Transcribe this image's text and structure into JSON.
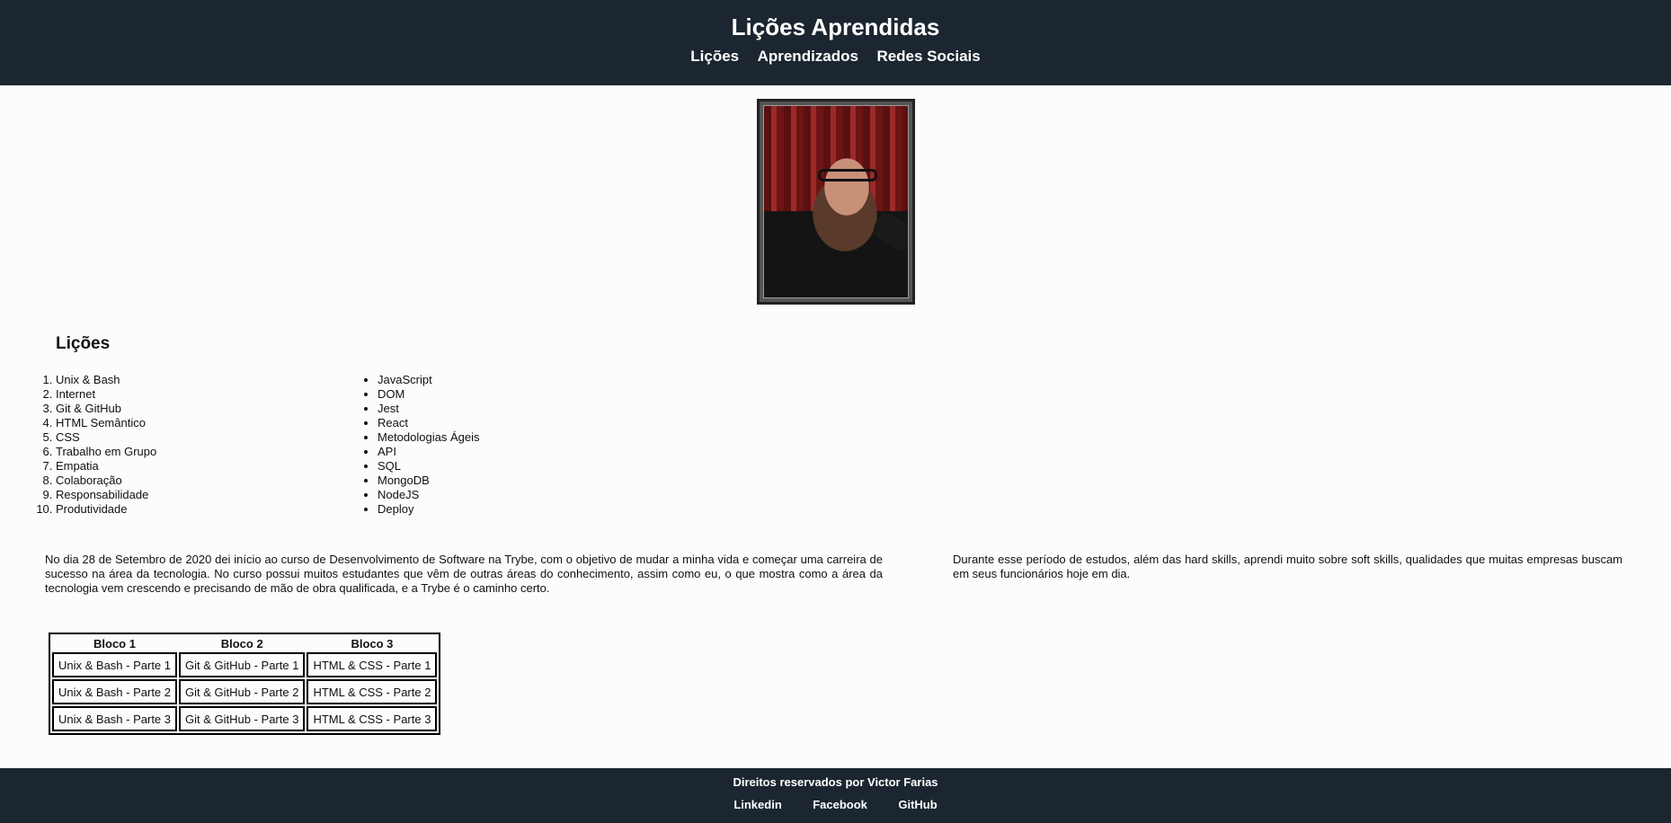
{
  "header": {
    "title": "Lições Aprendidas",
    "nav": [
      "Lições",
      "Aprendizados",
      "Redes Sociais"
    ]
  },
  "lessons": {
    "title": "Lições",
    "ordered": [
      "Unix & Bash",
      "Internet",
      "Git & GitHub",
      "HTML Semântico",
      "CSS",
      "Trabalho em Grupo",
      "Empatia",
      "Colaboração",
      "Responsabilidade",
      "Produtividade"
    ],
    "unordered": [
      "JavaScript",
      "DOM",
      "Jest",
      "React",
      "Metodologias Ágeis",
      "API",
      "SQL",
      "MongoDB",
      "NodeJS",
      "Deploy"
    ]
  },
  "paragraphs": {
    "left": "No dia 28 de Setembro de 2020 dei início ao curso de Desenvolvimento de Software na Trybe, com o objetivo de mudar a minha vida e começar uma carreira de sucesso na área da tecnologia. No curso possui muitos estudantes que vêm de outras áreas do conhecimento, assim como eu, o que mostra como a área da tecnologia vem crescendo e precisando de mão de obra qualificada, e a Trybe é o caminho certo.",
    "right": "Durante esse período de estudos, além das hard skills, aprendi muito sobre soft skills, qualidades que muitas empresas buscam em seus funcionários hoje em dia."
  },
  "table": {
    "headers": [
      "Bloco 1",
      "Bloco 2",
      "Bloco 3"
    ],
    "rows": [
      [
        "Unix & Bash - Parte 1",
        "Git & GitHub - Parte 1",
        "HTML & CSS - Parte 1"
      ],
      [
        "Unix & Bash - Parte 2",
        "Git & GitHub - Parte 2",
        "HTML & CSS - Parte 2"
      ],
      [
        "Unix & Bash - Parte 3",
        "Git & GitHub - Parte 3",
        "HTML & CSS - Parte 3"
      ]
    ]
  },
  "footer": {
    "credit": "Direitos reservados por Victor Farias",
    "links": [
      "Linkedin",
      "Facebook",
      "GitHub"
    ]
  },
  "colors": {
    "header_bg": "#1b2630",
    "page_bg": "#fdfbfb"
  }
}
